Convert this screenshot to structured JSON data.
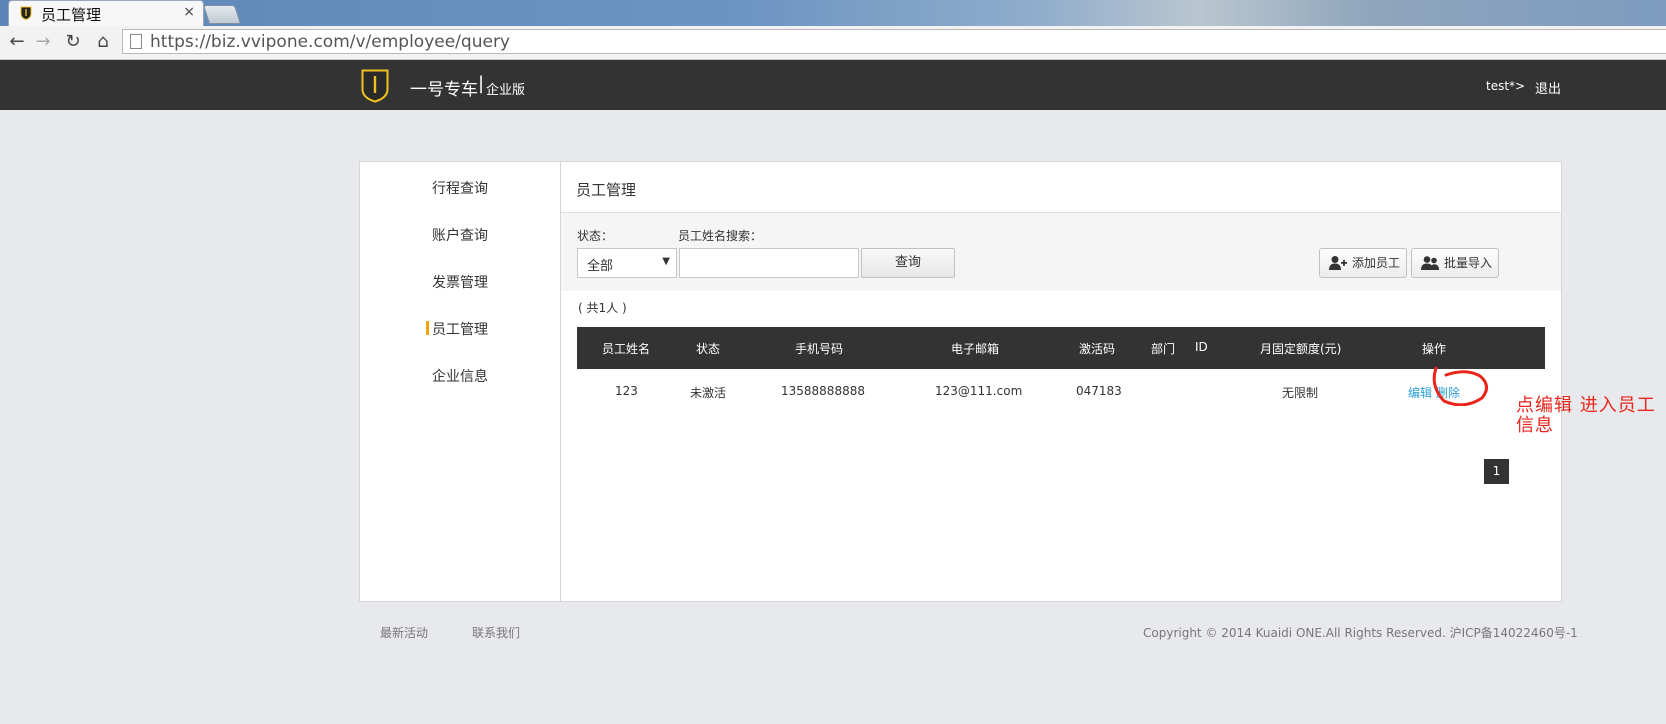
{
  "browser": {
    "tab_title": "员工管理",
    "tab_close": "×",
    "url": "https://biz.vvipone.com/v/employee/query",
    "back_glyph": "←",
    "forward_glyph": "→",
    "reload_glyph": "↻",
    "home_glyph": "⌂"
  },
  "header": {
    "brand_name": "一号专车",
    "brand_sep": "|",
    "brand_edition": "企业版",
    "user": "test*>",
    "logout": "退出",
    "shield_color": "#f0c020"
  },
  "sidebar": {
    "items": [
      {
        "label": "行程查询"
      },
      {
        "label": "账户查询"
      },
      {
        "label": "发票管理"
      },
      {
        "label": "员工管理",
        "active": true
      },
      {
        "label": "企业信息"
      }
    ]
  },
  "main": {
    "title": "员工管理",
    "filter": {
      "status_label": "状态：",
      "status_value": "全部",
      "name_label": "员工姓名搜索：",
      "name_value": "",
      "query_button": "查询"
    },
    "actions": {
      "add_employee": "添加员工",
      "batch_import": "批量导入"
    },
    "count_text": "( 共1人 )",
    "table": {
      "columns": [
        "员工姓名",
        "状态",
        "手机号码",
        "电子邮箱",
        "激活码",
        "部门",
        "ID",
        "月固定额度(元)",
        "操作"
      ],
      "rows": [
        {
          "name": "123",
          "status": "未激活",
          "phone": "13588888888",
          "email": "123@111.com",
          "activation_code": "047183",
          "department": "",
          "id": "",
          "monthly_limit": "无限制",
          "edit": "编辑",
          "delete": "删除"
        }
      ]
    },
    "pagination": {
      "current_page": "1"
    }
  },
  "annotation": {
    "text": "点编辑   进入员工信息",
    "color": "#e8261c"
  },
  "footer": {
    "links": [
      "最新活动",
      "联系我们"
    ],
    "copyright": "Copyright © 2014 Kuaidi ONE.All Rights Reserved. 沪ICP备14022460号-1"
  }
}
